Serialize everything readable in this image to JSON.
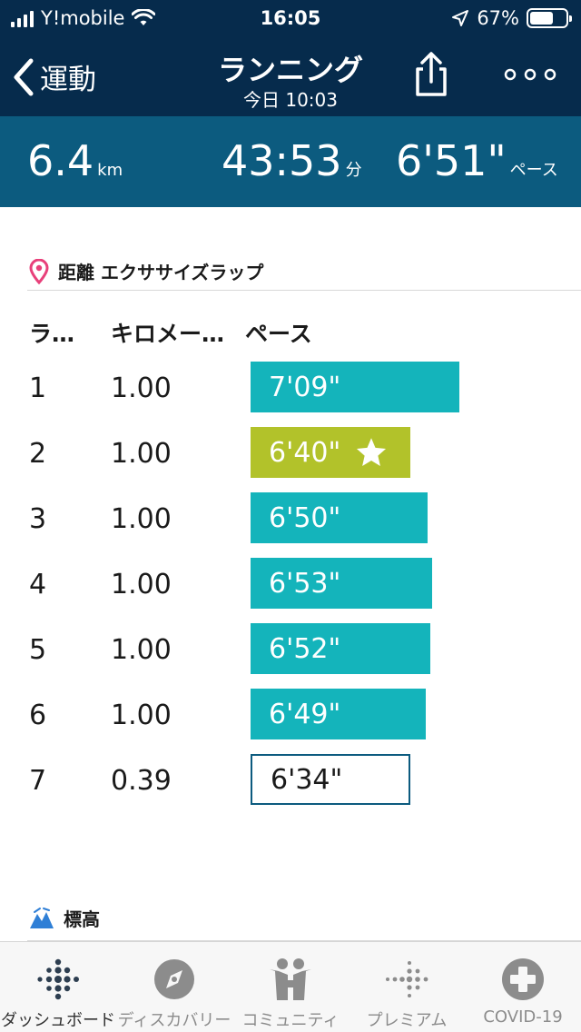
{
  "status_bar": {
    "carrier": "Y!mobile",
    "time": "16:05",
    "battery": "67%",
    "battery_level": 0.67
  },
  "nav": {
    "back_label": "運動",
    "title": "ランニング",
    "subtitle": "今日 10:03",
    "share_icon": "share-icon",
    "more_icon": "more-icon"
  },
  "summary": {
    "distance": {
      "value": "6.4",
      "unit": "km"
    },
    "duration": {
      "value": "43:53",
      "unit": "分"
    },
    "pace": {
      "value": "6'51\"",
      "unit": "ペース"
    }
  },
  "laps_section": {
    "title": "距離 エクササイズラップ",
    "icon": "location-pin-icon",
    "columns": [
      "ラ…",
      "キロメー…",
      "ペース"
    ],
    "colors": {
      "normal": "#14b4bb",
      "best": "#b2c22a",
      "partial_border": "#0c5b7f"
    },
    "rows": [
      {
        "lap": "1",
        "km": "1.00",
        "pace": "7'09\"",
        "pace_seconds": 429,
        "status": "normal"
      },
      {
        "lap": "2",
        "km": "1.00",
        "pace": "6'40\"",
        "pace_seconds": 400,
        "status": "best"
      },
      {
        "lap": "3",
        "km": "1.00",
        "pace": "6'50\"",
        "pace_seconds": 410,
        "status": "normal"
      },
      {
        "lap": "4",
        "km": "1.00",
        "pace": "6'53\"",
        "pace_seconds": 413,
        "status": "normal"
      },
      {
        "lap": "5",
        "km": "1.00",
        "pace": "6'52\"",
        "pace_seconds": 412,
        "status": "normal"
      },
      {
        "lap": "6",
        "km": "1.00",
        "pace": "6'49\"",
        "pace_seconds": 409,
        "status": "normal"
      },
      {
        "lap": "7",
        "km": "0.39",
        "pace": "6'34\"",
        "pace_seconds": 394,
        "status": "partial"
      }
    ]
  },
  "elevation_section": {
    "title": "標高",
    "icon": "mountain-icon"
  },
  "tabbar": {
    "tabs": [
      {
        "label": "ダッシュボード",
        "icon": "dashboard-icon",
        "active": true
      },
      {
        "label": "ディスカバリー",
        "icon": "compass-icon",
        "active": false
      },
      {
        "label": "コミュニティ",
        "icon": "community-icon",
        "active": false
      },
      {
        "label": "プレミアム",
        "icon": "premium-icon",
        "active": false
      },
      {
        "label": "COVID-19",
        "icon": "plus-circle-icon",
        "active": false
      }
    ]
  }
}
